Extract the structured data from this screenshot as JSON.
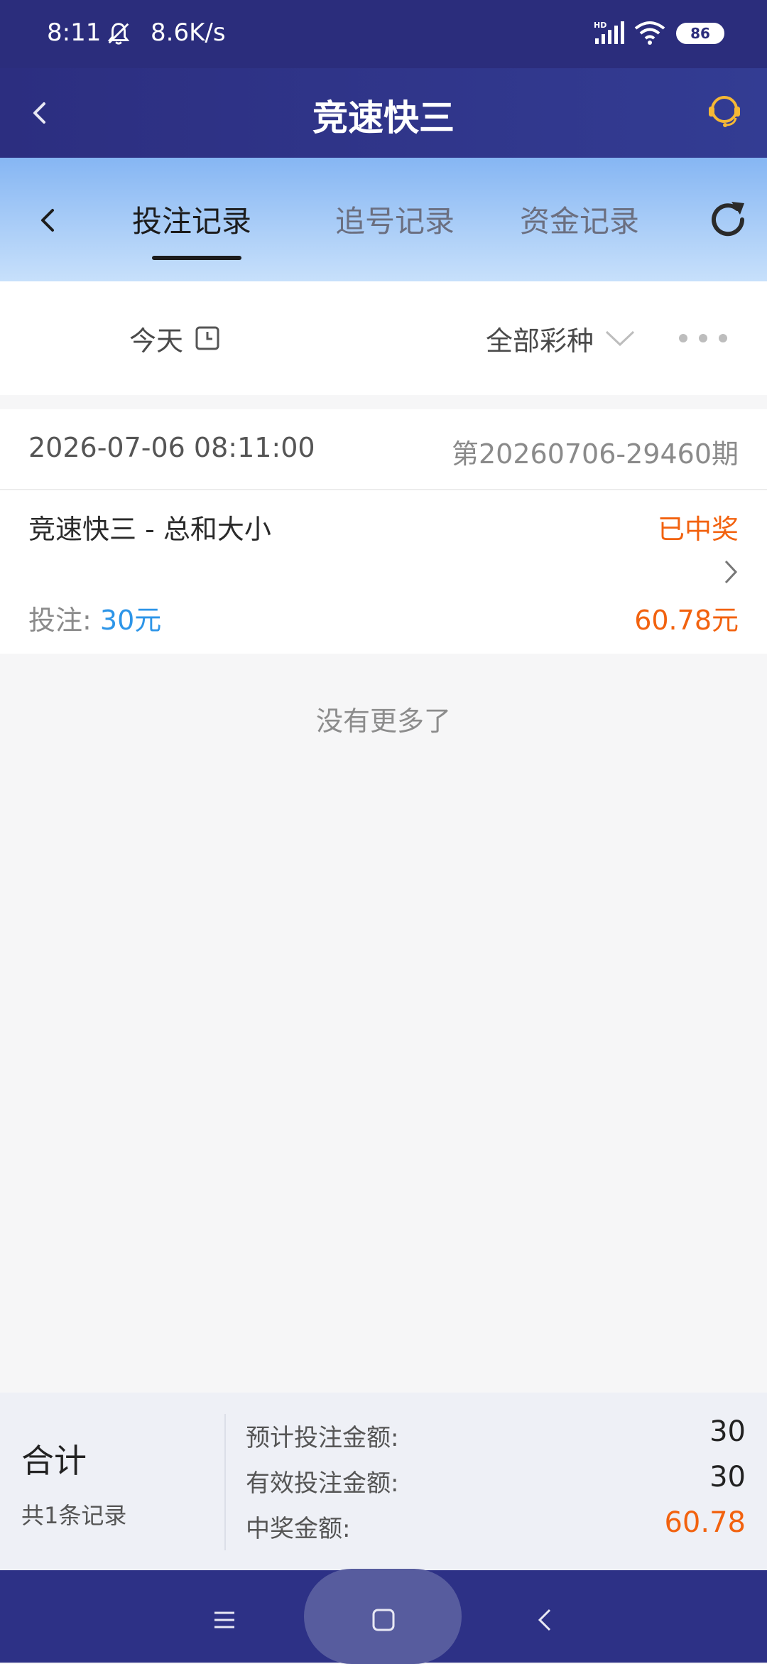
{
  "status_bar": {
    "time": "8:11",
    "speed": "8.6K/s",
    "battery": "86",
    "icons": [
      "bell-muted-icon",
      "signal-hd-icon",
      "wifi-icon",
      "battery-icon"
    ]
  },
  "header": {
    "title": "竞速快三",
    "icons": [
      "back-icon",
      "customer-service-icon"
    ],
    "accent_color": "#f5b835"
  },
  "tabs": {
    "items": [
      {
        "label": "投注记录",
        "active": true
      },
      {
        "label": "追号记录",
        "active": false
      },
      {
        "label": "资金记录",
        "active": false
      }
    ],
    "icons": [
      "back-icon",
      "refresh-icon"
    ]
  },
  "filters": {
    "date": "今天",
    "lottery": "全部彩种",
    "icons": [
      "calendar-icon",
      "chevron-down-icon",
      "more-icon"
    ]
  },
  "record": {
    "datetime": "2026-07-06 08:11:00",
    "issue": "第20260706-29460期",
    "game": "竞速快三 - 总和大小",
    "status": "已中奖",
    "bet_label": "投注: ",
    "bet_amount": "30元",
    "win_amount": "60.78元",
    "status_color": "#f2620f",
    "bet_color": "#2d95e8"
  },
  "list_end": "没有更多了",
  "summary": {
    "title": "合计",
    "count": "共1条记录",
    "rows": [
      {
        "label": "预计投注金额:",
        "value": "30"
      },
      {
        "label": "有效投注金额:",
        "value": "30"
      },
      {
        "label": "中奖金额:",
        "value": "60.78"
      }
    ]
  },
  "nav": {
    "icons": [
      "menu-icon",
      "home-icon",
      "back-icon"
    ]
  }
}
